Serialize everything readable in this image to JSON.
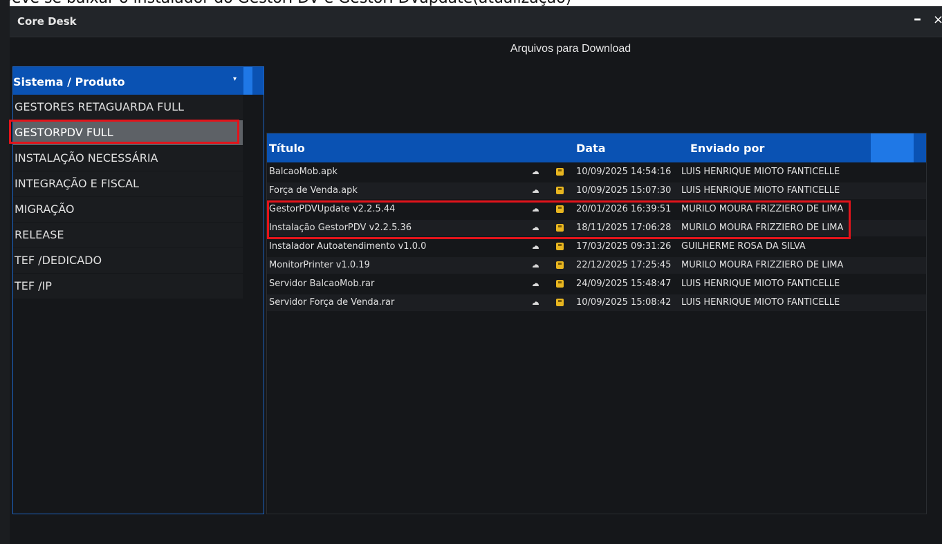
{
  "caption": "Deve se baixar o instalador do GestorPDV e GestorPDVupdate(atualização)",
  "window": {
    "title": "Core Desk",
    "minimize_glyph": "–",
    "close_glyph": "×"
  },
  "section_title": "Arquivos para Download",
  "sidebar": {
    "dropdown_label": "Sistema / Produto",
    "dropdown_arrow": "▾",
    "selected_index": 1,
    "items": [
      "GESTORES RETAGUARDA FULL",
      "GESTORPDV FULL",
      "INSTALAÇÃO NECESSÁRIA",
      "INTEGRAÇÃO E FISCAL",
      "MIGRAÇÃO",
      "RELEASE",
      "TEF /DEDICADO",
      "TEF /IP"
    ]
  },
  "table": {
    "columns": {
      "title": "Título",
      "date": "Data",
      "sender": "Enviado por"
    },
    "rows": [
      {
        "title": "BalcaoMob.apk",
        "date": "10/09/2025 14:54:16",
        "sender": "LUIS HENRIQUE MIOTO FANTICELLE"
      },
      {
        "title": "Força de Venda.apk",
        "date": "10/09/2025 15:07:30",
        "sender": "LUIS HENRIQUE MIOTO FANTICELLE"
      },
      {
        "title": "GestorPDVUpdate v2.2.5.44",
        "date": "20/01/2026 16:39:51",
        "sender": "MURILO MOURA FRIZZIERO DE LIMA"
      },
      {
        "title": "Instalação GestorPDV v2.2.5.36",
        "date": "18/11/2025 17:06:28",
        "sender": "MURILO MOURA FRIZZIERO DE LIMA"
      },
      {
        "title": "Instalador Autoatendimento v1.0.0",
        "date": "17/03/2025 09:31:26",
        "sender": "GUILHERME ROSA DA SILVA"
      },
      {
        "title": "MonitorPrinter v1.0.19",
        "date": "22/12/2025 17:25:45",
        "sender": "MURILO MOURA FRIZZIERO DE LIMA"
      },
      {
        "title": "Servidor BalcaoMob.rar",
        "date": "24/09/2025 15:48:47",
        "sender": "LUIS HENRIQUE MIOTO FANTICELLE"
      },
      {
        "title": "Servidor Força de Venda.rar",
        "date": "10/09/2025 15:08:42",
        "sender": "LUIS HENRIQUE MIOTO FANTICELLE"
      }
    ],
    "row_icons": [
      "cloud-icon",
      "save-icon"
    ]
  },
  "colors": {
    "header_blue": "#0a52b3",
    "accent_blue": "#1f78e6",
    "highlight_red": "#e3141b",
    "save_icon": "#e8b620"
  }
}
